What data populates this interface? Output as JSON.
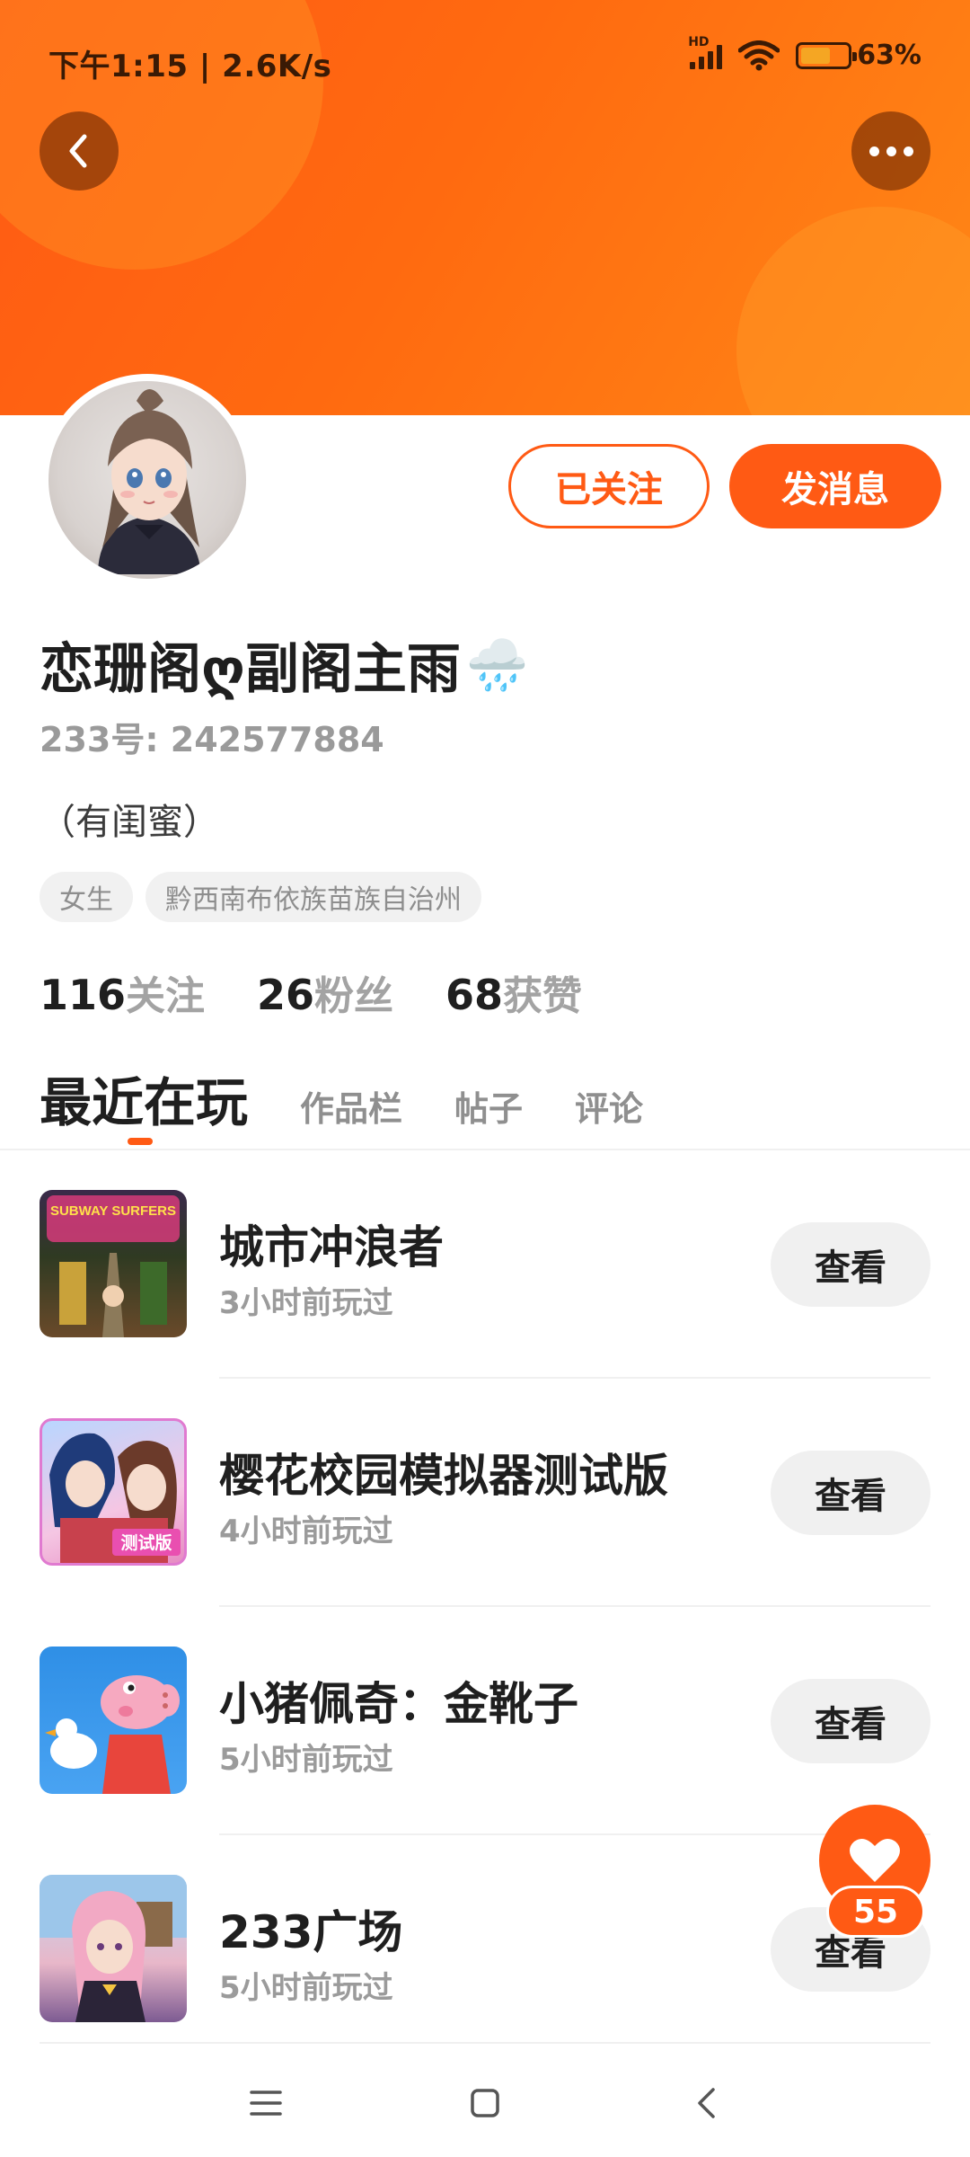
{
  "status_bar": {
    "time": "下午1:15 | 2.6K/s",
    "network_label": "HD",
    "battery_level": 0.63,
    "battery_text": "63%"
  },
  "header": {
    "back_icon": "chevron-left-icon",
    "more_icon": "more-horizontal-icon"
  },
  "profile": {
    "follow_label": "已关注",
    "message_label": "发消息",
    "username": "恋珊阁ღ副阁主雨",
    "username_emoji": "🌧️",
    "uid": "233号: 242577884",
    "bio": "（有闺蜜）",
    "tags": [
      "女生",
      "黔西南布依族苗族自治州"
    ],
    "stats": [
      {
        "num": "116",
        "label": "关注"
      },
      {
        "num": "26",
        "label": "粉丝"
      },
      {
        "num": "68",
        "label": "获赞"
      }
    ]
  },
  "tabs": [
    {
      "label": "最近在玩",
      "active": true
    },
    {
      "label": "作品栏",
      "active": false
    },
    {
      "label": "帖子",
      "active": false
    },
    {
      "label": "评论",
      "active": false
    }
  ],
  "recent_games": [
    {
      "title": "城市冲浪者",
      "played": "3小时前玩过",
      "button": "查看",
      "icon_text": "SUBWAY SURFERS"
    },
    {
      "title": "樱花校园模拟器测试版",
      "played": "4小时前玩过",
      "button": "查看",
      "icon_text": "测试版"
    },
    {
      "title": "小猪佩奇：金靴子",
      "played": "5小时前玩过",
      "button": "查看"
    },
    {
      "title": "233广场",
      "played": "5小时前玩过",
      "button": "查看"
    }
  ],
  "fab": {
    "icon": "heart-icon",
    "count": "55"
  },
  "colors": {
    "accent": "#ff5a14",
    "banner_start": "#ff5a14",
    "banner_end": "#ff8716"
  }
}
